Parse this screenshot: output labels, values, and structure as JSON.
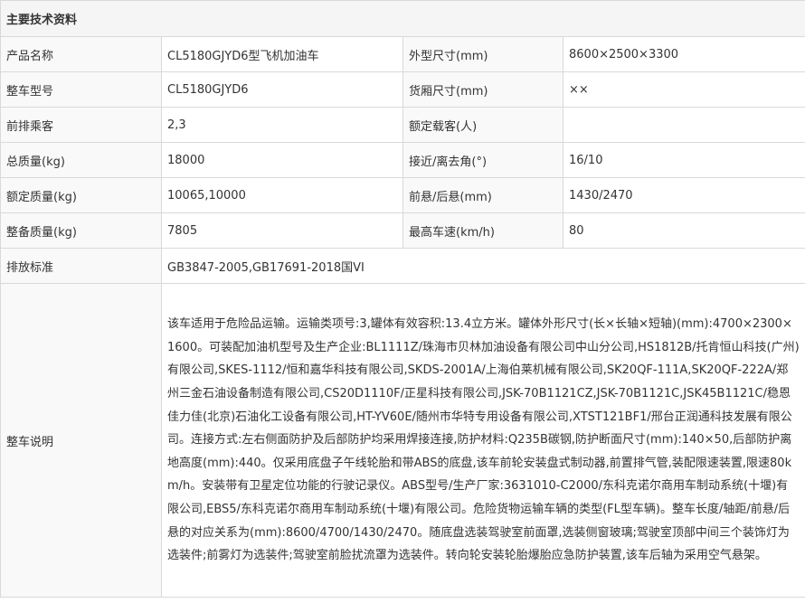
{
  "title": "主要技术资料",
  "rows": [
    {
      "label1": "产品名称",
      "value1": "CL5180GJYD6型飞机加油车",
      "label2": "外型尺寸(mm)",
      "value2": "8600×2500×3300"
    },
    {
      "label1": "整车型号",
      "value1": "CL5180GJYD6",
      "label2": "货厢尺寸(mm)",
      "value2": "××"
    },
    {
      "label1": "前排乘客",
      "value1": "2,3",
      "label2": "额定载客(人)",
      "value2": ""
    },
    {
      "label1": "总质量(kg)",
      "value1": "18000",
      "label2": "接近/离去角(°)",
      "value2": "16/10"
    },
    {
      "label1": "额定质量(kg)",
      "value1": "10065,10000",
      "label2": "前悬/后悬(mm)",
      "value2": "1430/2470"
    },
    {
      "label1": "整备质量(kg)",
      "value1": "7805",
      "label2": "最高车速(km/h)",
      "value2": "80"
    }
  ],
  "emission": {
    "label": "排放标准",
    "value": "GB3847-2005,GB17691-2018国VI"
  },
  "description": {
    "label": "整车说明",
    "text": "该车适用于危险品运输。运输类项号:3,罐体有效容积:13.4立方米。罐体外形尺寸(长×长轴×短轴)(mm):4700×2300×1600。可装配加油机型号及生产企业:BL1111Z/珠海市贝林加油设备有限公司中山分公司,HS1812B/托肯恒山科技(广州)有限公司,SKES-1112/恒和嘉华科技有限公司,SKDS-2001A/上海伯莱机械有限公司,SK20QF-111A,SK20QF-222A/郑州三金石油设备制造有限公司,CS20D1110F/正星科技有限公司,JSK-70B1121CZ,JSK-70B1121C,JSK45B1121C/稳恩佳力佳(北京)石油化工设备有限公司,HT-YV60E/随州市华特专用设备有限公司,XTST121BF1/邢台正润通科技发展有限公司。连接方式:左右侧面防护及后部防护均采用焊接连接,防护材料:Q235B碳钢,防护断面尺寸(mm):140×50,后部防护离地高度(mm):440。仅采用底盘子午线轮胎和带ABS的底盘,该车前轮安装盘式制动器,前置排气管,装配限速装置,限速80km/h。安装带有卫星定位功能的行驶记录仪。ABS型号/生产厂家:3631010-C2000/东科克诺尔商用车制动系统(十堰)有限公司,EBS5/东科克诺尔商用车制动系统(十堰)有限公司。危险货物运输车辆的类型(FL型车辆)。整车长度/轴距/前悬/后悬的对应关系为(mm):8600/4700/1430/2470。随底盘选装驾驶室前面罩,选装侧窗玻璃;驾驶室顶部中间三个装饰灯为选装件;前雾灯为选装件;驾驶室前脸扰流罩为选装件。转向轮安装轮胎爆胎应急防护装置,该车后轴为采用空气悬架。"
  }
}
